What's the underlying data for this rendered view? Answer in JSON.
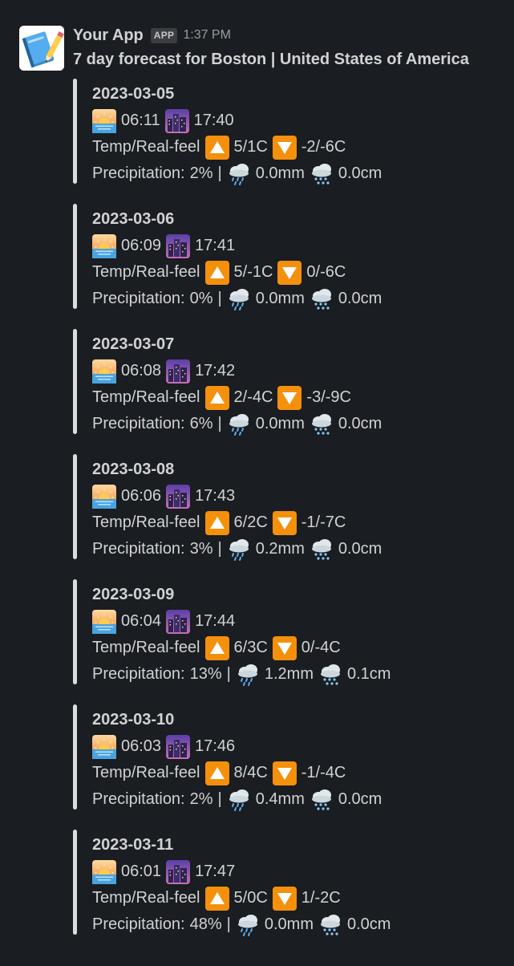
{
  "app": {
    "name": "Your App",
    "badge": "APP",
    "time": "1:37 PM"
  },
  "title": "7 day forecast for Boston | United States of America",
  "labels": {
    "temp_prefix": "Temp/Real-feel",
    "precip_prefix": "Precipitation:",
    "pipe": "|"
  },
  "icons": {
    "avatar": "notebook-pencil-icon",
    "sunrise": "sunrise-icon",
    "sunset": "city-sunset-icon",
    "high": "up-triangle-icon",
    "low": "down-triangle-icon",
    "rain": "rain-cloud-icon",
    "snow": "snow-cloud-icon"
  },
  "colors": {
    "background": "#1a1d21",
    "text": "#d1d2d3",
    "bar": "#dcddde",
    "triangle": "#f4900c"
  },
  "days": [
    {
      "date": "2023-03-05",
      "sunrise": "06:11",
      "sunset": "17:40",
      "high": "5/1C",
      "low": "-2/-6C",
      "precip": "2%",
      "rain": "0.0mm",
      "snow": "0.0cm"
    },
    {
      "date": "2023-03-06",
      "sunrise": "06:09",
      "sunset": "17:41",
      "high": "5/-1C",
      "low": "0/-6C",
      "precip": "0%",
      "rain": "0.0mm",
      "snow": "0.0cm"
    },
    {
      "date": "2023-03-07",
      "sunrise": "06:08",
      "sunset": "17:42",
      "high": "2/-4C",
      "low": "-3/-9C",
      "precip": "6%",
      "rain": "0.0mm",
      "snow": "0.0cm"
    },
    {
      "date": "2023-03-08",
      "sunrise": "06:06",
      "sunset": "17:43",
      "high": "6/2C",
      "low": "-1/-7C",
      "precip": "3%",
      "rain": "0.2mm",
      "snow": "0.0cm"
    },
    {
      "date": "2023-03-09",
      "sunrise": "06:04",
      "sunset": "17:44",
      "high": "6/3C",
      "low": "0/-4C",
      "precip": "13%",
      "rain": "1.2mm",
      "snow": "0.1cm"
    },
    {
      "date": "2023-03-10",
      "sunrise": "06:03",
      "sunset": "17:46",
      "high": "8/4C",
      "low": "-1/-4C",
      "precip": "2%",
      "rain": "0.4mm",
      "snow": "0.0cm"
    },
    {
      "date": "2023-03-11",
      "sunrise": "06:01",
      "sunset": "17:47",
      "high": "5/0C",
      "low": "1/-2C",
      "precip": "48%",
      "rain": "0.0mm",
      "snow": "0.0cm"
    }
  ]
}
